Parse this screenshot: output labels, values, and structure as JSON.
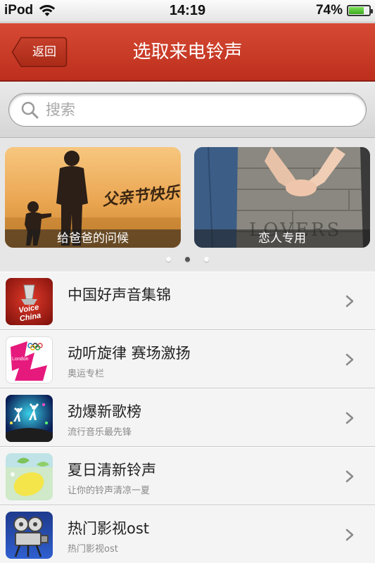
{
  "status_bar": {
    "carrier": "iPod",
    "time": "14:19",
    "battery_text": "74%",
    "battery_level": 0.74
  },
  "nav": {
    "back_label": "返回",
    "title": "选取来电铃声",
    "bar_color": "#c93a25"
  },
  "search": {
    "placeholder": "搜索"
  },
  "banners": [
    {
      "caption": "给爸爸的问候",
      "art_text": "父亲节快乐"
    },
    {
      "caption": "恋人专用",
      "art_text": "LOVERS"
    }
  ],
  "carousel": {
    "page_count": 3,
    "active_index": 1
  },
  "list": [
    {
      "title": "中国好声音集锦",
      "subtitle": "",
      "thumb": "voice-china-logo",
      "art_text": "Voice China"
    },
    {
      "title": "动听旋律 赛场激扬",
      "subtitle": "奥运专栏",
      "thumb": "london-2012-logo",
      "art_text": "London"
    },
    {
      "title": "劲爆新歌榜",
      "subtitle": "流行音乐最先锋",
      "thumb": "dancers-graphic"
    },
    {
      "title": "夏日清新铃声",
      "subtitle": "让你的铃声清凉一夏",
      "thumb": "lemon-graphic"
    },
    {
      "title": "热门影视ost",
      "subtitle": "热门影视ost",
      "thumb": "film-projector-graphic"
    }
  ]
}
